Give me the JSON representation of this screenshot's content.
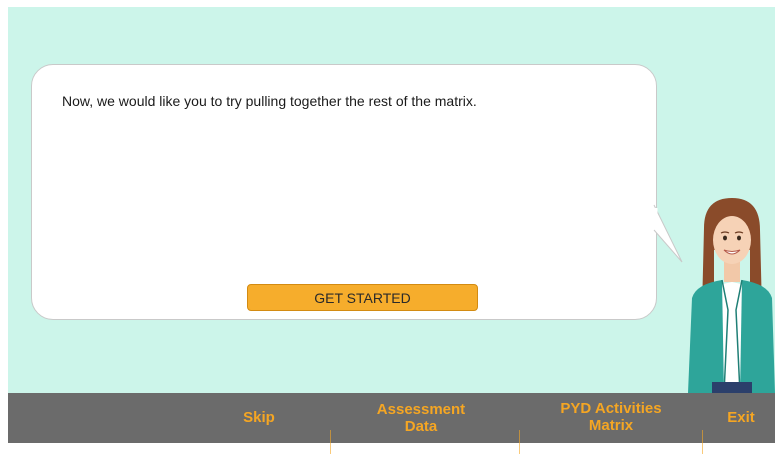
{
  "dialog": {
    "message": "Now, we would like you to try pulling together the rest of the matrix.",
    "button_label": "GET STARTED"
  },
  "nav": {
    "skip": "Skip",
    "assessment_line1": "Assessment",
    "assessment_line2": "Data",
    "pyd_line1": "PYD Activities",
    "pyd_line2": "Matrix",
    "exit": "Exit"
  },
  "colors": {
    "background": "#ccf5ea",
    "accent": "#f5a623",
    "button": "#f6ad2c",
    "navbar": "#6b6b6b"
  },
  "icons": {
    "character": "guide-avatar"
  }
}
